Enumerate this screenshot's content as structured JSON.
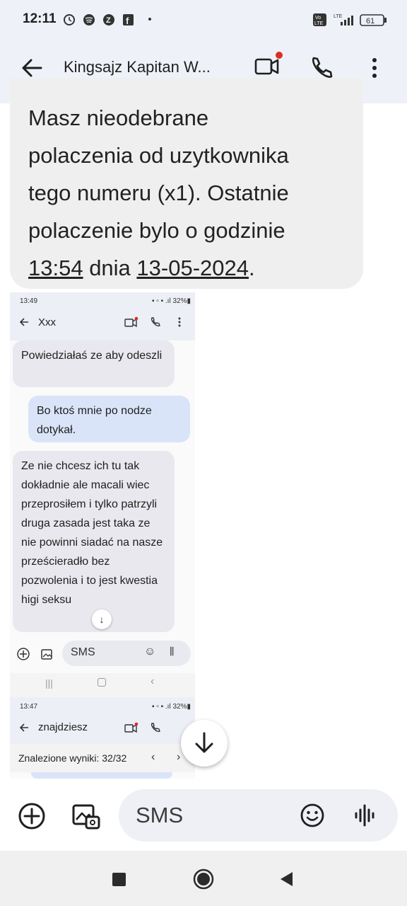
{
  "status_bar": {
    "time": "12:11",
    "battery": "61",
    "network": "LTE"
  },
  "app_bar": {
    "title": "Kingsajz Kapitan W..."
  },
  "message": {
    "line1": "Masz nieodebrane",
    "line2": "polaczenia od uzytkownika",
    "line3": "tego numeru (x1). Ostatnie",
    "line4": "polaczenie bylo o godzinie",
    "time_link": "13:54",
    "mid": " dnia ",
    "date_link": "13-05-2024",
    "end": "."
  },
  "screenshot1": {
    "time": "13:49",
    "battery": "32%",
    "title": "Xxx",
    "bubble1": "Powiedziałaś ze aby odeszli",
    "bubble2": "Bo ktoś mnie po nodze dotykał.",
    "bubble3": "Ze nie chcesz ich tu tak dokładnie ale macali wiec przeprosiłem i tylko patrzyli druga zasada jest taka ze nie powinni siadać na nasze prześcieradło bez pozwolenia i to jest kwestia higi  seksu",
    "composer": "SMS"
  },
  "screenshot2": {
    "time": "13:47",
    "battery": "32%",
    "title": "znajdziesz",
    "results": "Znalezione wyniki: 32/32"
  },
  "composer": {
    "placeholder": "SMS"
  },
  "colors": {
    "bar_bg": "#eef1f7",
    "bubble_in": "#efefef",
    "accent_dot": "#d93025"
  }
}
